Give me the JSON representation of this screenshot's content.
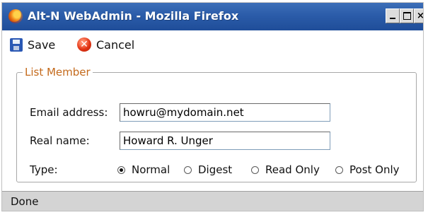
{
  "window": {
    "title": "Alt-N WebAdmin - Mozilla Firefox",
    "controls": {
      "minimize": "_",
      "maximize": "□",
      "close": "×"
    }
  },
  "toolbar": {
    "save_label": "Save",
    "save_icon": "floppy-disk-icon",
    "cancel_label": "Cancel",
    "cancel_icon": "cancel-icon"
  },
  "form": {
    "legend": "List Member",
    "email_label": "Email address:",
    "email_value": "howru@mydomain.net",
    "realname_label": "Real name:",
    "realname_value": "Howard R. Unger",
    "type_label": "Type:",
    "type_options": [
      {
        "label": "Normal",
        "checked": true
      },
      {
        "label": "Digest",
        "checked": false
      },
      {
        "label": "Read Only",
        "checked": false
      },
      {
        "label": "Post Only",
        "checked": false
      }
    ]
  },
  "status": {
    "text": "Done"
  },
  "colors": {
    "titlebar": "#2b5ca9",
    "legend_text": "#c46a1c",
    "statusbar": "#d4d4d4"
  }
}
